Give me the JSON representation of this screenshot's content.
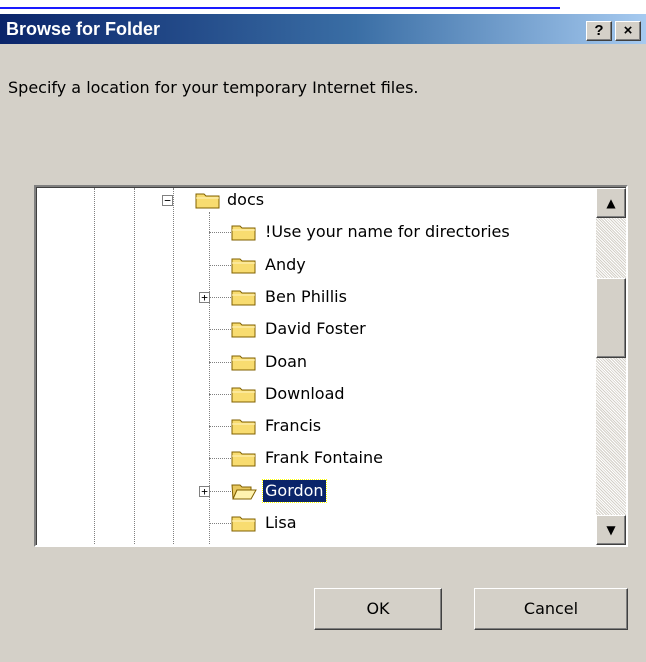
{
  "window": {
    "title": "Browse for Folder",
    "help_glyph": "?",
    "close_glyph": "×"
  },
  "prompt": "Specify a location for your temporary Internet files.",
  "tree": {
    "items": [
      {
        "label": "docs",
        "expander": "−"
      },
      {
        "label": "!Use your name for directories"
      },
      {
        "label": "Andy"
      },
      {
        "label": "Ben Phillis",
        "expander": "+"
      },
      {
        "label": "David Foster"
      },
      {
        "label": "Doan"
      },
      {
        "label": "Download"
      },
      {
        "label": "Francis"
      },
      {
        "label": "Frank Fontaine"
      },
      {
        "label": "Gordon",
        "expander": "+",
        "selected": true
      },
      {
        "label": "Lisa"
      }
    ]
  },
  "scrollbar": {
    "up_glyph": "▲",
    "down_glyph": "▼"
  },
  "buttons": {
    "ok": "OK",
    "cancel": "Cancel"
  },
  "colors": {
    "title_start": "#0a246a",
    "title_end": "#a6caf0",
    "selection": "#0a246a",
    "dialog_bg": "#d4d0c8"
  }
}
